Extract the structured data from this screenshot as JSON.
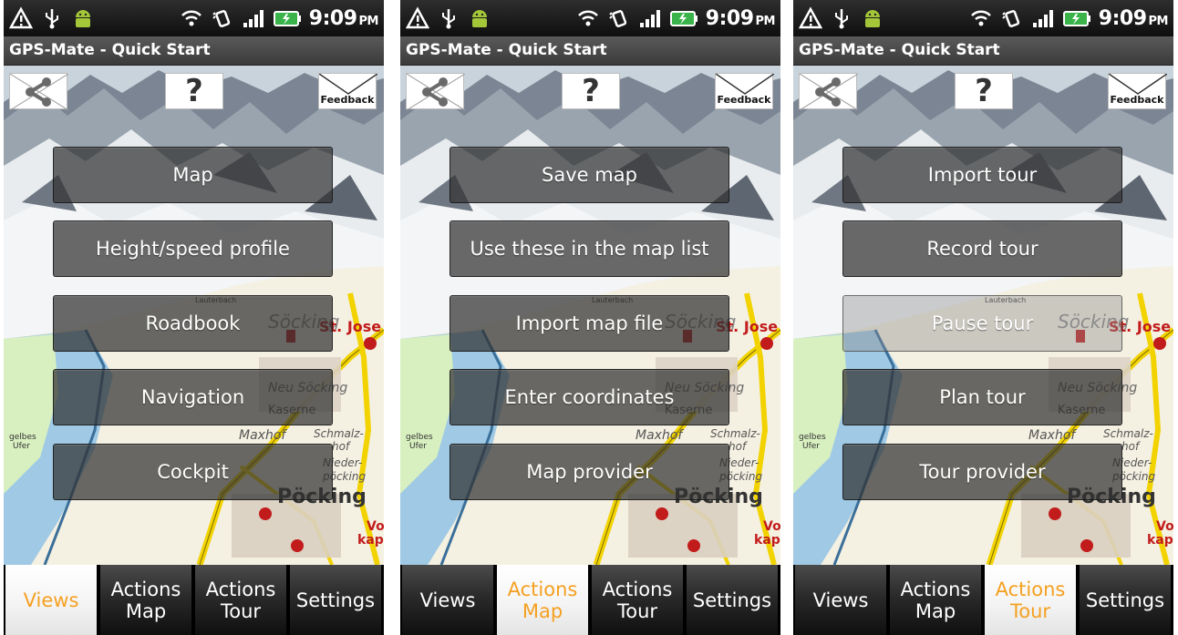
{
  "status_bar": {
    "time": "9:09",
    "ampm": "PM",
    "icons": [
      "warning-icon",
      "usb-icon",
      "android-icon",
      "wifi-icon",
      "vibrate-icon",
      "signal-icon",
      "battery-charging-icon"
    ]
  },
  "colors": {
    "active_tab_text": "#f5a020",
    "button_bg": "#323232",
    "title_bar": "#4a4a4a"
  },
  "icons": {
    "share": "share-icon",
    "help": "help-icon",
    "feedback": "envelope-icon"
  },
  "screens": [
    {
      "title": "GPS-Mate - Quick Start",
      "help_label": "?",
      "feedback_label": "Feedback",
      "buttons": [
        "Map",
        "Height/speed profile",
        "Roadbook",
        "Navigation",
        "Cockpit"
      ],
      "tabs": [
        "Views",
        "Actions\nMap",
        "Actions\nTour",
        "Settings"
      ],
      "active_tab": 0
    },
    {
      "title": "GPS-Mate - Quick Start",
      "help_label": "?",
      "feedback_label": "Feedback",
      "buttons": [
        "Save map",
        "Use these in the map list",
        "Import map file",
        "Enter coordinates",
        "Map provider"
      ],
      "tabs": [
        "Views",
        "Actions\nMap",
        "Actions\nTour",
        "Settings"
      ],
      "active_tab": 1
    },
    {
      "title": "GPS-Mate - Quick Start",
      "help_label": "?",
      "feedback_label": "Feedback",
      "buttons": [
        "Import tour",
        "Record tour",
        "Pause tour",
        "Plan tour",
        "Tour provider"
      ],
      "tabs": [
        "Views",
        "Actions\nMap",
        "Actions\nTour",
        "Settings"
      ],
      "active_tab": 2,
      "disabled_button": 2
    }
  ],
  "map_labels": [
    "Söcking",
    "St. Jose",
    "Neu Söcking",
    "Kaserne",
    "Maxhof",
    "Schmalz-\nhof",
    "Nieder-\npöcking",
    "Pöcking",
    "Vo\nkape",
    "gelbes\nUfer",
    "Lauterbach"
  ]
}
